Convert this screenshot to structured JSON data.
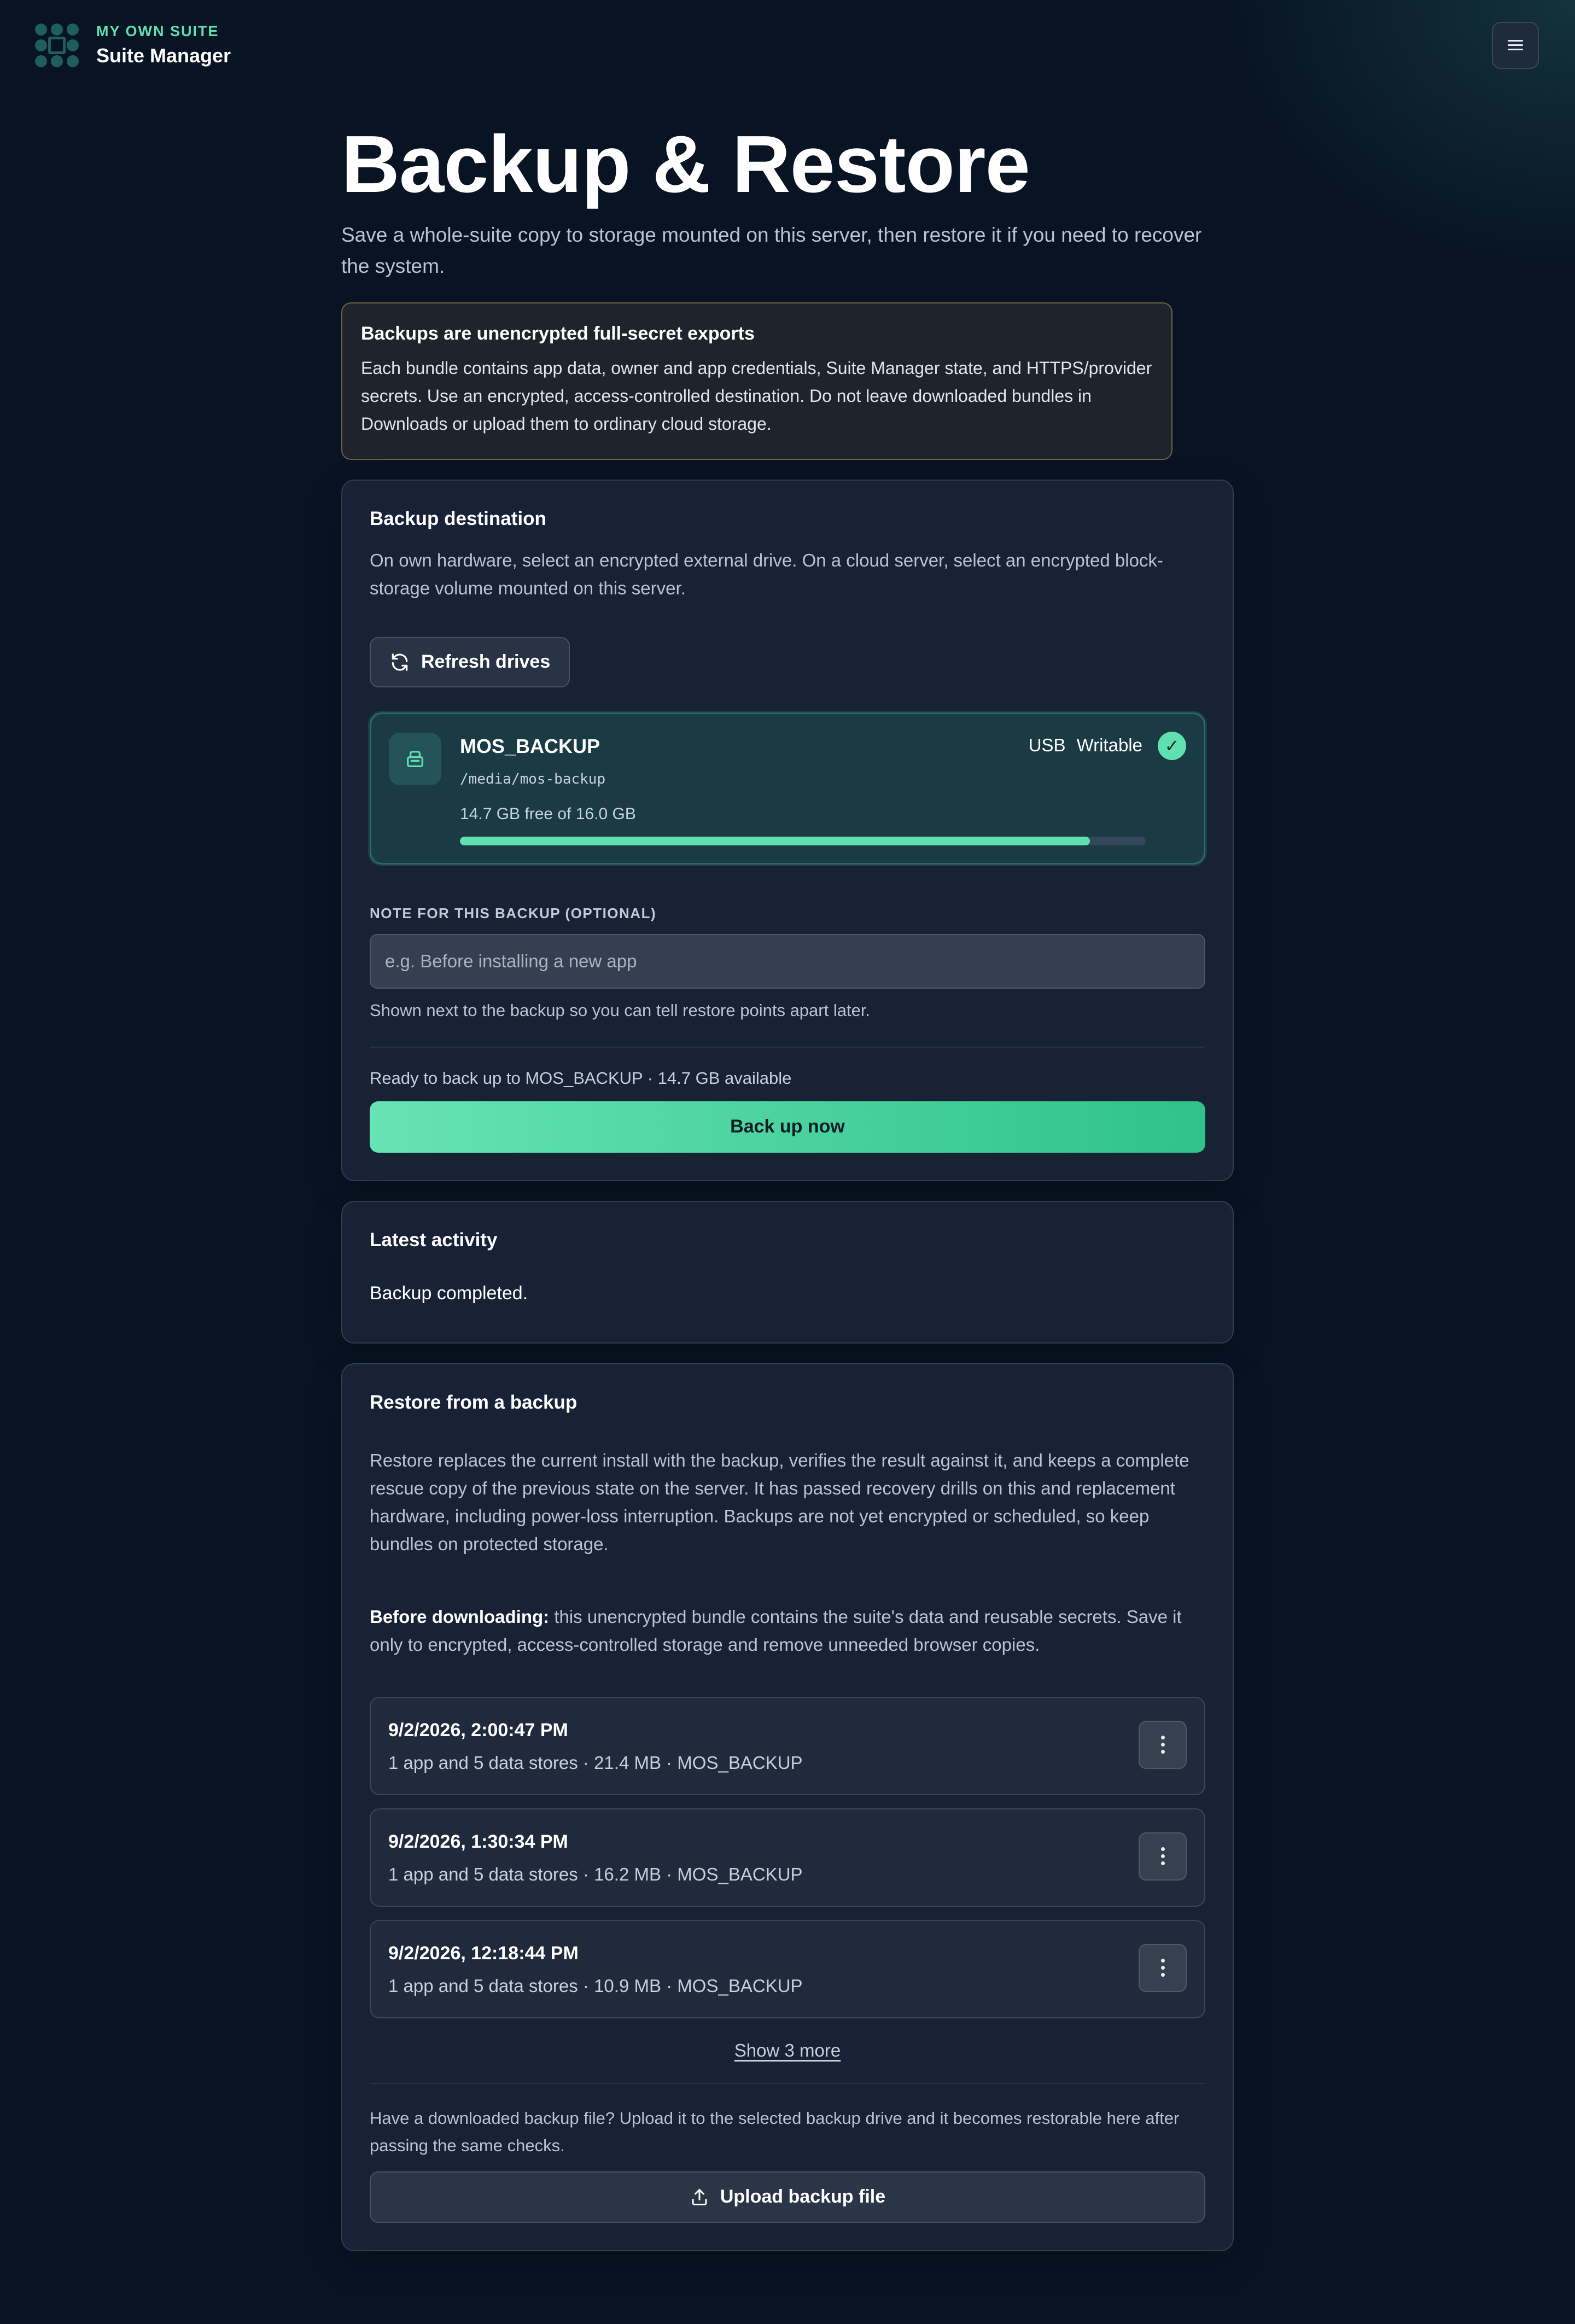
{
  "header": {
    "kicker": "MY OWN SUITE",
    "app_name": "Suite Manager",
    "logo_icon": "grid-logo-icon",
    "menu_icon": "menu-icon"
  },
  "page": {
    "title": "Backup & Restore",
    "subtitle": "Save a whole-suite copy to storage mounted on this server, then restore it if you need to recover the system."
  },
  "warning": {
    "title": "Backups are unencrypted full-secret exports",
    "body": "Each bundle contains app data, owner and app credentials, Suite Manager state, and HTTPS/provider secrets. Use an encrypted, access-controlled destination. Do not leave downloaded bundles in Downloads or upload them to ordinary cloud storage."
  },
  "destination": {
    "title": "Backup destination",
    "description": "On own hardware, select an encrypted external drive. On a cloud server, select an encrypted block-storage volume mounted on this server.",
    "refresh_label": "Refresh drives",
    "drive": {
      "name": "MOS_BACKUP",
      "path": "/media/mos-backup",
      "free_text": "14.7 GB free of 16.0 GB",
      "free_fraction": 0.919,
      "tag_type": "USB",
      "tag_status": "Writable",
      "check": "✓"
    },
    "note_label": "NOTE FOR THIS BACKUP (OPTIONAL)",
    "note_placeholder": "e.g. Before installing a new app",
    "note_value": "",
    "note_help": "Shown next to the backup so you can tell restore points apart later.",
    "ready_text": "Ready to back up to MOS_BACKUP · 14.7 GB available",
    "backup_button": "Back up now"
  },
  "activity": {
    "title": "Latest activity",
    "text": "Backup completed."
  },
  "restore": {
    "title": "Restore from a backup",
    "description": "Restore replaces the current install with the backup, verifies the result against it, and keeps a complete rescue copy of the previous state on the server. It has passed recovery drills on this and replacement hardware, including power-loss interruption. Backups are not yet encrypted or scheduled, so keep bundles on protected storage.",
    "warn_bold": "Before downloading:",
    "warn_rest": " this unencrypted bundle contains the suite's data and reusable secrets. Save it only to encrypted, access-controlled storage and remove unneeded browser copies.",
    "backups": [
      {
        "date": "9/2/2026, 2:00:47 PM",
        "meta": "1 app and 5 data stores · 21.4 MB · MOS_BACKUP"
      },
      {
        "date": "9/2/2026, 1:30:34 PM",
        "meta": "1 app and 5 data stores · 16.2 MB · MOS_BACKUP"
      },
      {
        "date": "9/2/2026, 12:18:44 PM",
        "meta": "1 app and 5 data stores · 10.9 MB · MOS_BACKUP"
      }
    ],
    "show_more": "Show 3 more",
    "upload_text": "Have a downloaded backup file? Upload it to the selected backup drive and it becomes restorable here after passing the same checks.",
    "upload_button": "Upload backup file"
  },
  "colors": {
    "accent": "#5fe0b0",
    "background": "#081424",
    "card": "#172236",
    "warning_border": "#6b6446"
  }
}
